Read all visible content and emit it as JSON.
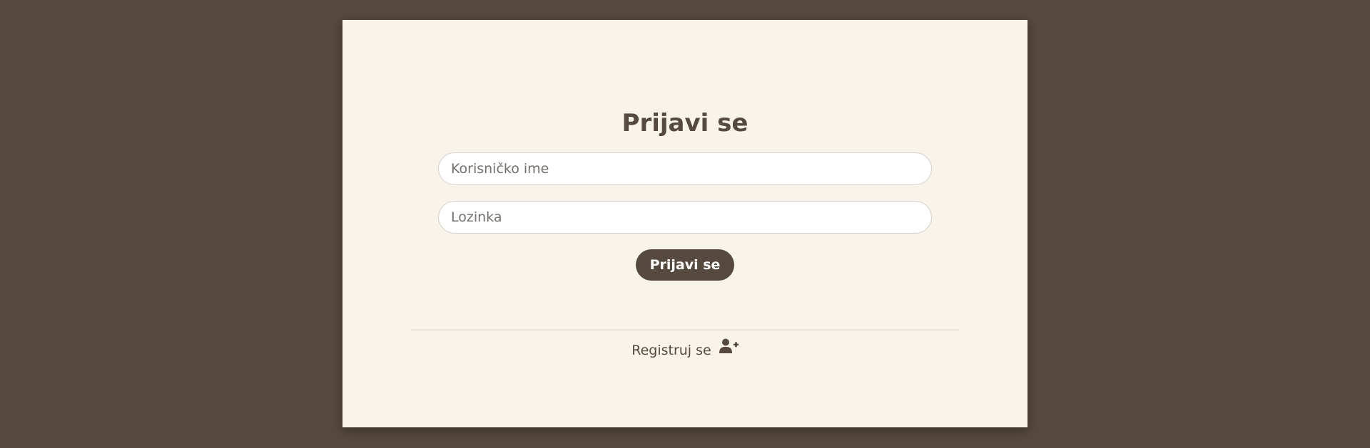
{
  "login": {
    "title": "Prijavi se",
    "username_placeholder": "Korisničko ime",
    "password_placeholder": "Lozinka",
    "submit_label": "Prijavi se",
    "register_label": "Registruj se",
    "register_icon": "user-plus-icon"
  },
  "colors": {
    "background": "#56493d",
    "card": "#f9f4ea",
    "accent": "#56493d",
    "button_text": "#ffffff"
  }
}
